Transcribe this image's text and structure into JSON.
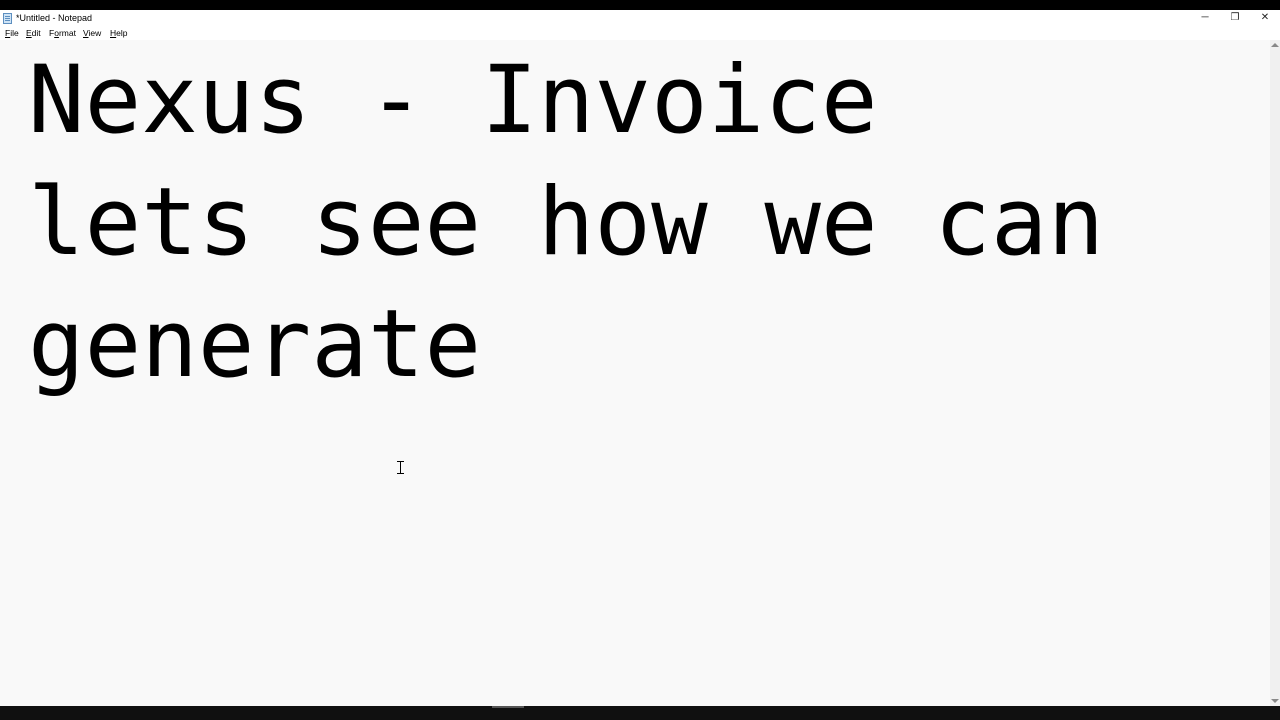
{
  "window": {
    "title": "*Untitled - Notepad",
    "controls": {
      "minimize": "─",
      "maximize": "❐",
      "close": "✕"
    }
  },
  "menu": {
    "file": {
      "accel": "F",
      "rest": "ile"
    },
    "edit": {
      "accel": "E",
      "rest": "dit"
    },
    "format": {
      "pre": "F",
      "accel": "o",
      "rest": "rmat"
    },
    "view": {
      "accel": "V",
      "rest": "iew"
    },
    "help": {
      "accel": "H",
      "rest": "elp"
    }
  },
  "editor": {
    "lines": [
      "Nexus - Invoice",
      "lets see how we can",
      "generate"
    ]
  },
  "icons": {
    "app": "notepad-icon",
    "cursor": "text-cursor-icon"
  }
}
